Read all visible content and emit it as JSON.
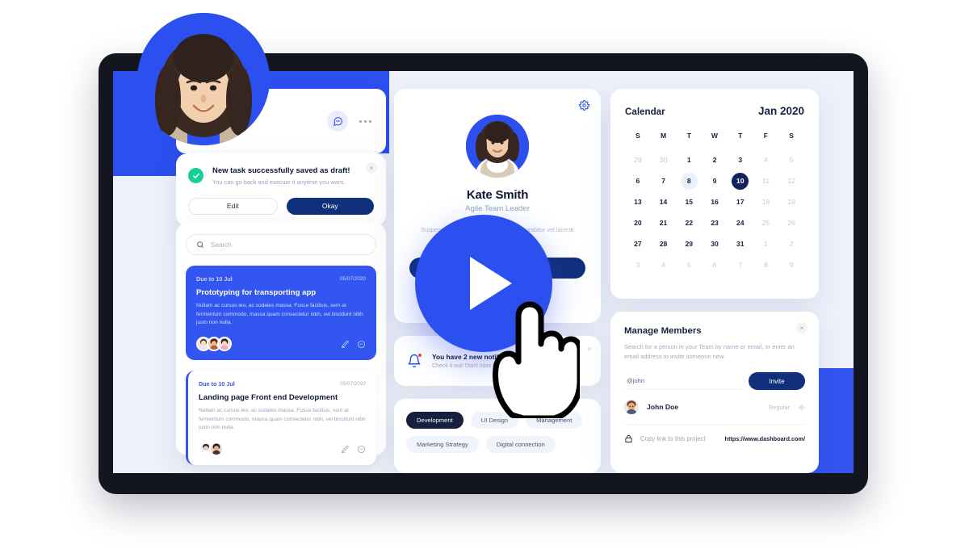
{
  "theme": {
    "accent_blue": "#3355f0",
    "deep_navy": "#11307c",
    "dark_navy": "#16213f",
    "success_green": "#17cf97",
    "notif_red": "#f0453a",
    "screen_bg": "#eef1fb"
  },
  "left": {
    "topbar": {
      "chat_icon": "chat-bubble-icon",
      "menu_icon": "more-options-icon"
    },
    "toast": {
      "title": "New task successfully saved as draft!",
      "subtitle": "You can go back and execute it anytime you want.",
      "close_label": "×",
      "edit_label": "Edit",
      "okay_label": "Okay"
    },
    "search": {
      "placeholder": "Search",
      "value": "",
      "icon": "search-icon"
    },
    "tasks": [
      {
        "due": "Due to 10 Jul",
        "date": "05/07/2020",
        "title": "Prototyping for transporting app",
        "body": "Nullam ac cursus leo, ac sodales massa. Fusce facilisis, sem at fermentum commodo, massa quam consectetur nibh, vel tincidunt nibh justo non nulla.",
        "avatar_count": 3,
        "edit_icon": "pencil-icon",
        "comment_icon": "comment-icon"
      },
      {
        "due": "Due to 10 Jul",
        "date": "05/07/2020",
        "title": "Landing page Front end Development",
        "body": "Nullam ac cursus leo, ac sodales massa. Fusce facilisis, sem at fermentum commodo, massa quam consectetur nibh, vel tincidunt nibh justo non nulla.",
        "avatar_count": 2,
        "edit_icon": "pencil-icon",
        "comment_icon": "comment-icon"
      }
    ]
  },
  "center": {
    "profile": {
      "settings_icon": "gear-icon",
      "name": "Kate Smith",
      "role": "Agile Team Leader",
      "description": "Suspendisse sed sodales sed massa. Curabitur vel lacerat commodo elementum",
      "action_label": ""
    },
    "notification": {
      "icon": "bell-icon",
      "title": "You have 2 new notifications",
      "subtitle": "Check it out! Don't miss important",
      "close_label": "×"
    },
    "tags": [
      {
        "label": "Development",
        "active": true
      },
      {
        "label": "UI Design",
        "active": false
      },
      {
        "label": "Management",
        "active": false
      },
      {
        "label": "Marketing Strategy",
        "active": false
      },
      {
        "label": "Digital connection",
        "active": false
      }
    ]
  },
  "right": {
    "calendar": {
      "title": "Calendar",
      "month": "Jan 2020",
      "weekdays": [
        "S",
        "M",
        "T",
        "W",
        "T",
        "F",
        "S"
      ],
      "weeks": [
        [
          {
            "d": "29",
            "state": "muted"
          },
          {
            "d": "30",
            "state": "muted"
          },
          {
            "d": "1",
            "state": "normal"
          },
          {
            "d": "2",
            "state": "normal"
          },
          {
            "d": "3",
            "state": "normal"
          },
          {
            "d": "4",
            "state": "muted"
          },
          {
            "d": "5",
            "state": "muted"
          }
        ],
        [
          {
            "d": "6",
            "state": "normal"
          },
          {
            "d": "7",
            "state": "normal"
          },
          {
            "d": "8",
            "state": "hl"
          },
          {
            "d": "9",
            "state": "normal"
          },
          {
            "d": "10",
            "state": "sel"
          },
          {
            "d": "11",
            "state": "muted"
          },
          {
            "d": "12",
            "state": "muted"
          }
        ],
        [
          {
            "d": "13",
            "state": "normal"
          },
          {
            "d": "14",
            "state": "normal"
          },
          {
            "d": "15",
            "state": "normal"
          },
          {
            "d": "16",
            "state": "normal"
          },
          {
            "d": "17",
            "state": "normal"
          },
          {
            "d": "18",
            "state": "muted"
          },
          {
            "d": "19",
            "state": "muted"
          }
        ],
        [
          {
            "d": "20",
            "state": "normal"
          },
          {
            "d": "21",
            "state": "normal"
          },
          {
            "d": "22",
            "state": "normal"
          },
          {
            "d": "23",
            "state": "normal"
          },
          {
            "d": "24",
            "state": "normal"
          },
          {
            "d": "25",
            "state": "muted"
          },
          {
            "d": "26",
            "state": "muted"
          }
        ],
        [
          {
            "d": "27",
            "state": "normal"
          },
          {
            "d": "28",
            "state": "normal"
          },
          {
            "d": "29",
            "state": "normal"
          },
          {
            "d": "30",
            "state": "normal"
          },
          {
            "d": "31",
            "state": "normal"
          },
          {
            "d": "1",
            "state": "muted"
          },
          {
            "d": "2",
            "state": "muted"
          }
        ],
        [
          {
            "d": "3",
            "state": "muted"
          },
          {
            "d": "4",
            "state": "muted"
          },
          {
            "d": "5",
            "state": "muted"
          },
          {
            "d": "6",
            "state": "muted"
          },
          {
            "d": "7",
            "state": "muted"
          },
          {
            "d": "8",
            "state": "muted"
          },
          {
            "d": "9",
            "state": "muted"
          }
        ]
      ]
    },
    "manage_members": {
      "title": "Manage Members",
      "subtitle": "Search for a person in your Team by name or email, or enter an email address to invite someone new.",
      "close_label": "×",
      "invite_value": "@john",
      "invite_placeholder": "@john",
      "invite_button": "Invite",
      "member": {
        "name": "John Doe",
        "role": "Regular",
        "settings_icon": "gear-icon"
      },
      "copy_link_label": "Copy link to this project",
      "copy_link_icon": "lock-icon",
      "url": "https://www.dashboard.com/"
    }
  },
  "overlay": {
    "play_button": "play-button",
    "cursor": "hand-cursor"
  }
}
